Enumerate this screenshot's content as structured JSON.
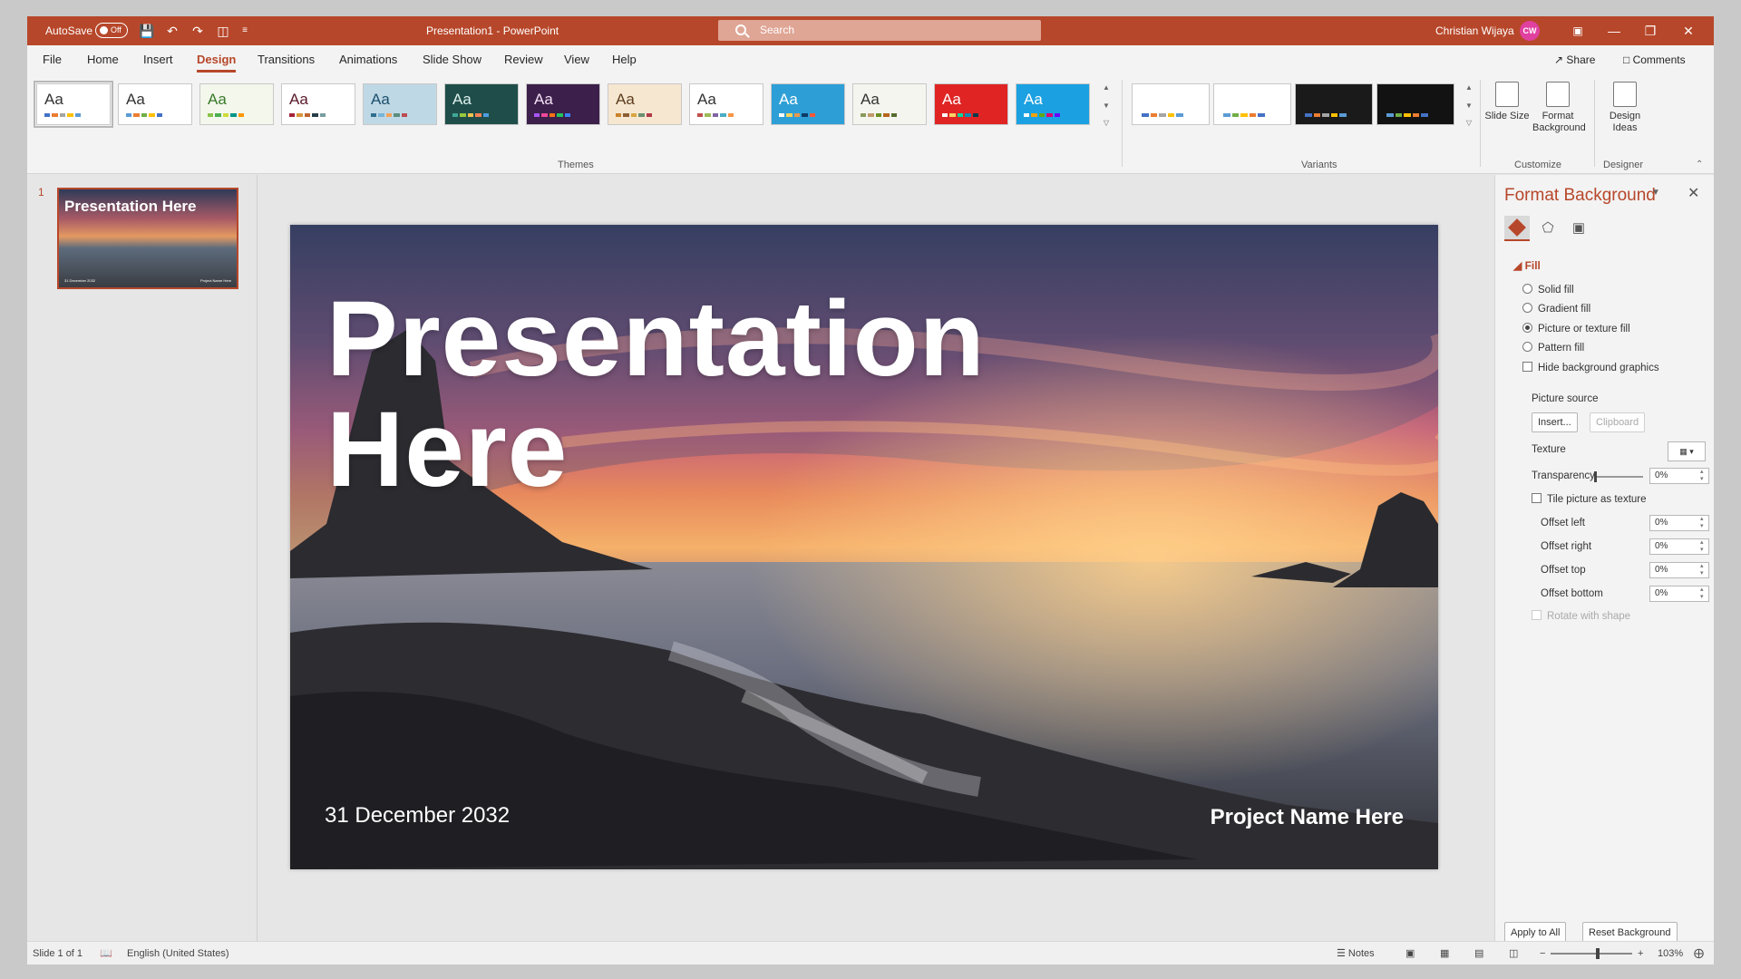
{
  "titlebar": {
    "autosave_label": "AutoSave",
    "autosave_state": "Off",
    "document_title": "Presentation1  -  PowerPoint",
    "search_placeholder": "Search",
    "user_name": "Christian Wijaya",
    "user_initials": "CW"
  },
  "menu": {
    "tabs": [
      "File",
      "Home",
      "Insert",
      "Design",
      "Transitions",
      "Animations",
      "Slide Show",
      "Review",
      "View",
      "Help"
    ],
    "active_tab": "Design",
    "share_label": "Share",
    "comments_label": "Comments"
  },
  "ribbon": {
    "theme_tile_label": "Aa",
    "themes_group_label": "Themes",
    "variants_group_label": "Variants",
    "customize_group_label": "Customize",
    "designer_group_label": "Designer",
    "slide_size_label": "Slide Size",
    "format_background_label": "Format Background",
    "design_ideas_label": "Design Ideas",
    "themes": [
      {
        "bg": "#ffffff",
        "text": "#333333",
        "bars": [
          "#4472c4",
          "#ed7d31",
          "#a5a5a5",
          "#ffc000",
          "#5b9bd5"
        ]
      },
      {
        "bg": "#ffffff",
        "text": "#333333",
        "bars": [
          "#5b9bd5",
          "#ed7d31",
          "#70ad47",
          "#ffc000",
          "#4472c4"
        ]
      },
      {
        "bg": "#f3f7ec",
        "text": "#3a7a2a",
        "bars": [
          "#8bc34a",
          "#4caf50",
          "#cddc39",
          "#009688",
          "#ff9800"
        ]
      },
      {
        "bg": "#ffffff",
        "text": "#5a1a2a",
        "bars": [
          "#a4243b",
          "#d8973c",
          "#bd632f",
          "#273e47",
          "#7a9e9f"
        ]
      },
      {
        "bg": "#bfd8e6",
        "text": "#1c4f6b",
        "bars": [
          "#2f6f8f",
          "#77b5d9",
          "#f4a259",
          "#5b8e7d",
          "#bc4b51"
        ]
      },
      {
        "bg": "#1f4e4a",
        "text": "#e0f2ef",
        "bars": [
          "#3fa796",
          "#97c93d",
          "#f2c14e",
          "#f78154",
          "#4d9de0"
        ]
      },
      {
        "bg": "#3c1f4a",
        "text": "#f3e1f7",
        "bars": [
          "#a855f7",
          "#ec4899",
          "#f97316",
          "#22c55e",
          "#3b82f6"
        ]
      },
      {
        "bg": "#f6e7d0",
        "text": "#5c3d1e",
        "bars": [
          "#c9822b",
          "#8b5e34",
          "#d9a441",
          "#6b8f71",
          "#b23a48"
        ]
      },
      {
        "bg": "#ffffff",
        "text": "#333333",
        "bars": [
          "#c0504d",
          "#9bbb59",
          "#8064a2",
          "#4bacc6",
          "#f79646"
        ]
      },
      {
        "bg": "#2e9fd6",
        "text": "#ffffff",
        "bars": [
          "#ffffff",
          "#f4d35e",
          "#ee964b",
          "#0d3b66",
          "#f95738"
        ]
      },
      {
        "bg": "#f5f5ef",
        "text": "#333333",
        "bars": [
          "#8a9a5b",
          "#c19a6b",
          "#6b8e23",
          "#b5651d",
          "#556b2f"
        ]
      },
      {
        "bg": "#e02424",
        "text": "#ffffff",
        "bars": [
          "#ffffff",
          "#ffd166",
          "#06d6a0",
          "#118ab2",
          "#073b4c"
        ]
      },
      {
        "bg": "#1ba1e2",
        "text": "#ffffff",
        "bars": [
          "#ffffff",
          "#f0a30a",
          "#60a917",
          "#d80073",
          "#6a00ff"
        ]
      }
    ],
    "variants": [
      {
        "bg": "#ffffff",
        "bars": [
          "#4472c4",
          "#ed7d31",
          "#a5a5a5",
          "#ffc000",
          "#5b9bd5"
        ]
      },
      {
        "bg": "#ffffff",
        "bars": [
          "#5b9bd5",
          "#70ad47",
          "#ffc000",
          "#ed7d31",
          "#4472c4"
        ]
      },
      {
        "bg": "#1a1a1a",
        "bars": [
          "#4472c4",
          "#ed7d31",
          "#a5a5a5",
          "#ffc000",
          "#5b9bd5"
        ]
      },
      {
        "bg": "#121212",
        "bars": [
          "#5b9bd5",
          "#70ad47",
          "#ffc000",
          "#ed7d31",
          "#4472c4"
        ]
      }
    ]
  },
  "thumbnails": {
    "slide_number": "1",
    "title": "Presentation Here",
    "date": "31 December 2032",
    "project": "Project Name Here"
  },
  "slide": {
    "title_line1": "Presentation",
    "title_line2": "Here",
    "date": "31 December 2032",
    "project": "Project Name Here"
  },
  "format_pane": {
    "title": "Format Background",
    "fill_section": "Fill",
    "solid_fill": "Solid fill",
    "gradient_fill": "Gradient fill",
    "picture_fill": "Picture or texture fill",
    "pattern_fill": "Pattern fill",
    "hide_graphics": "Hide background graphics",
    "picture_source": "Picture source",
    "insert_label": "Insert...",
    "clipboard_label": "Clipboard",
    "texture_label": "Texture",
    "transparency_label": "Transparency",
    "transparency_value": "0%",
    "tile_label": "Tile picture as texture",
    "offset_left_label": "Offset left",
    "offset_left_value": "0%",
    "offset_right_label": "Offset right",
    "offset_right_value": "0%",
    "offset_top_label": "Offset top",
    "offset_top_value": "0%",
    "offset_bottom_label": "Offset bottom",
    "offset_bottom_value": "0%",
    "rotate_label": "Rotate with shape",
    "apply_all_label": "Apply to All",
    "reset_label": "Reset Background"
  },
  "status": {
    "slide_info": "Slide 1 of 1",
    "language": "English (United States)",
    "notes_label": "Notes",
    "zoom_level": "103%"
  },
  "colors": {
    "accent": "#b7472a"
  }
}
